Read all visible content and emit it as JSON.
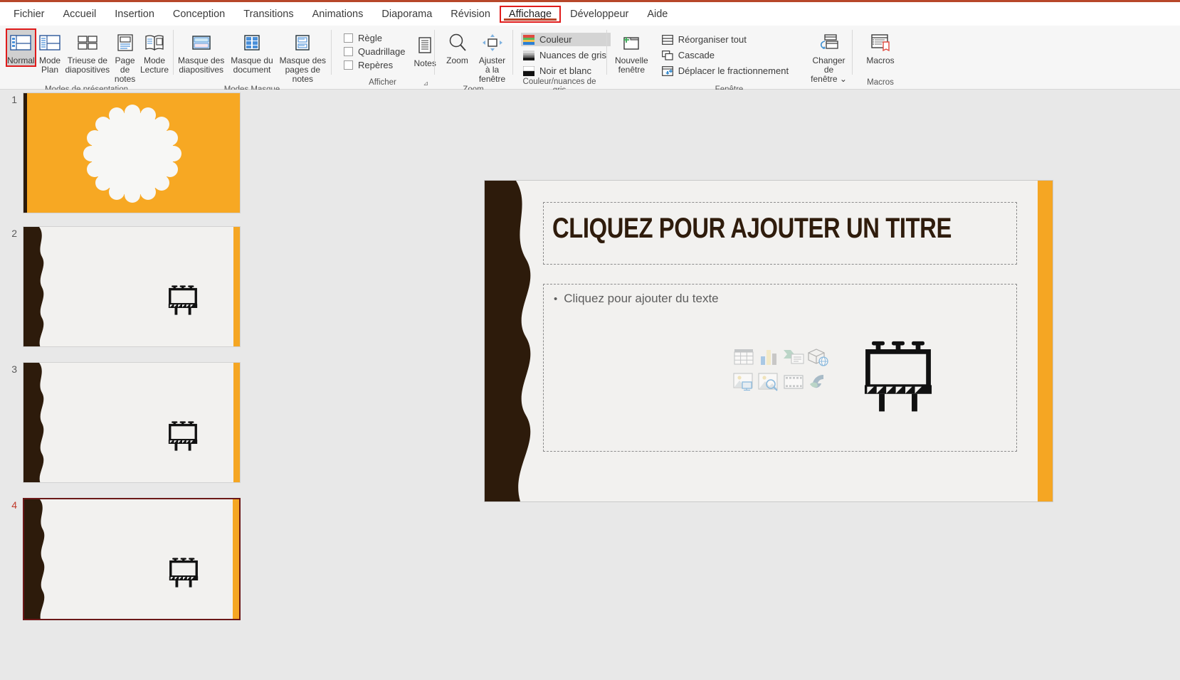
{
  "app": {
    "title": "PowerPoint",
    "accent_color": "#b7472a",
    "highlight_color": "#e01b1b"
  },
  "tabs": [
    {
      "label": "Fichier",
      "active": false
    },
    {
      "label": "Accueil",
      "active": false
    },
    {
      "label": "Insertion",
      "active": false
    },
    {
      "label": "Conception",
      "active": false
    },
    {
      "label": "Transitions",
      "active": false
    },
    {
      "label": "Animations",
      "active": false
    },
    {
      "label": "Diaporama",
      "active": false
    },
    {
      "label": "Révision",
      "active": false
    },
    {
      "label": "Affichage",
      "active": true
    },
    {
      "label": "Développeur",
      "active": false
    },
    {
      "label": "Aide",
      "active": false
    }
  ],
  "ribbon": {
    "groups": [
      {
        "name": "presentation-views",
        "label": "Modes de présentation",
        "buttons": [
          {
            "label": "Normal",
            "icon": "normal-view-icon",
            "selected": true
          },
          {
            "label": "Mode Plan",
            "icon": "outline-view-icon",
            "selected": false
          },
          {
            "label": "Trieuse de diapositives",
            "icon": "slide-sorter-icon",
            "selected": false
          },
          {
            "label": "Page de notes",
            "icon": "notes-page-icon",
            "selected": false
          },
          {
            "label": "Mode Lecture",
            "icon": "reading-view-icon",
            "selected": false
          }
        ]
      },
      {
        "name": "master-views",
        "label": "Modes Masque",
        "buttons": [
          {
            "label": "Masque des diapositives",
            "icon": "slide-master-icon",
            "selected": false
          },
          {
            "label": "Masque du document",
            "icon": "handout-master-icon",
            "selected": false
          },
          {
            "label": "Masque des pages de notes",
            "icon": "notes-master-icon",
            "selected": false
          }
        ]
      },
      {
        "name": "show",
        "label": "Afficher",
        "dialog_launcher": "⊿",
        "checkboxes": [
          {
            "label": "Règle",
            "checked": false
          },
          {
            "label": "Quadrillage",
            "checked": false
          },
          {
            "label": "Repères",
            "checked": false
          }
        ],
        "buttons": [
          {
            "label": "Notes",
            "icon": "notes-icon",
            "selected": false
          }
        ]
      },
      {
        "name": "zoom",
        "label": "Zoom",
        "buttons": [
          {
            "label": "Zoom",
            "icon": "magnifier-icon",
            "selected": false
          },
          {
            "label": "Ajuster à la fenêtre",
            "icon": "fit-to-window-icon",
            "selected": false
          }
        ]
      },
      {
        "name": "color-grayscale",
        "label": "Couleur/nuances de gris",
        "options": [
          {
            "label": "Couleur",
            "icon": "color-swatch-icon",
            "selected": true
          },
          {
            "label": "Nuances de gris",
            "icon": "grayscale-swatch-icon",
            "selected": false
          },
          {
            "label": "Noir et blanc",
            "icon": "blackwhite-swatch-icon",
            "selected": false
          }
        ]
      },
      {
        "name": "window",
        "label": "Fenêtre",
        "buttons": [
          {
            "label": "Nouvelle fenêtre",
            "icon": "new-window-icon",
            "selected": false
          }
        ],
        "options": [
          {
            "label": "Réorganiser tout",
            "icon": "arrange-all-icon"
          },
          {
            "label": "Cascade",
            "icon": "cascade-icon"
          },
          {
            "label": "Déplacer le fractionnement",
            "icon": "move-split-icon"
          }
        ],
        "switch_button": {
          "label": "Changer de fenêtre",
          "icon": "switch-windows-icon",
          "chevron": "⌄"
        }
      },
      {
        "name": "macros",
        "label": "Macros",
        "buttons": [
          {
            "label": "Macros",
            "icon": "macros-icon",
            "selected": false
          }
        ]
      }
    ]
  },
  "thumbnails": {
    "slides": [
      {
        "number": "1",
        "selected": false,
        "type": "title",
        "accent": "#f7a823",
        "shape": "scalloped-circle",
        "shape_color": "#f7f7f5"
      },
      {
        "number": "2",
        "selected": false,
        "type": "content",
        "billboard": true
      },
      {
        "number": "3",
        "selected": false,
        "type": "content",
        "billboard": true
      },
      {
        "number": "4",
        "selected": true,
        "type": "content",
        "billboard": true
      }
    ],
    "selected_number": "4"
  },
  "slide_editor": {
    "background": "#f2f1ef",
    "wave_color": "#2d1b0b",
    "orange_strip_color": "#f5a623",
    "title_placeholder": {
      "text": "CLIQUEZ POUR AJOUTER UN TITRE",
      "color": "#2f1c0c"
    },
    "body_placeholder": {
      "bullet": "•",
      "text": "Cliquez pour ajouter du texte",
      "color": "#5d5d5d"
    },
    "insert_icons": [
      {
        "name": "insert-table-icon"
      },
      {
        "name": "insert-chart-icon"
      },
      {
        "name": "insert-smartart-icon"
      },
      {
        "name": "insert-3d-model-icon"
      },
      {
        "name": "insert-picture-icon"
      },
      {
        "name": "insert-online-pictures-icon"
      },
      {
        "name": "insert-video-icon"
      },
      {
        "name": "insert-icons-icon"
      }
    ],
    "decoration_icon": "billboard-icon"
  }
}
